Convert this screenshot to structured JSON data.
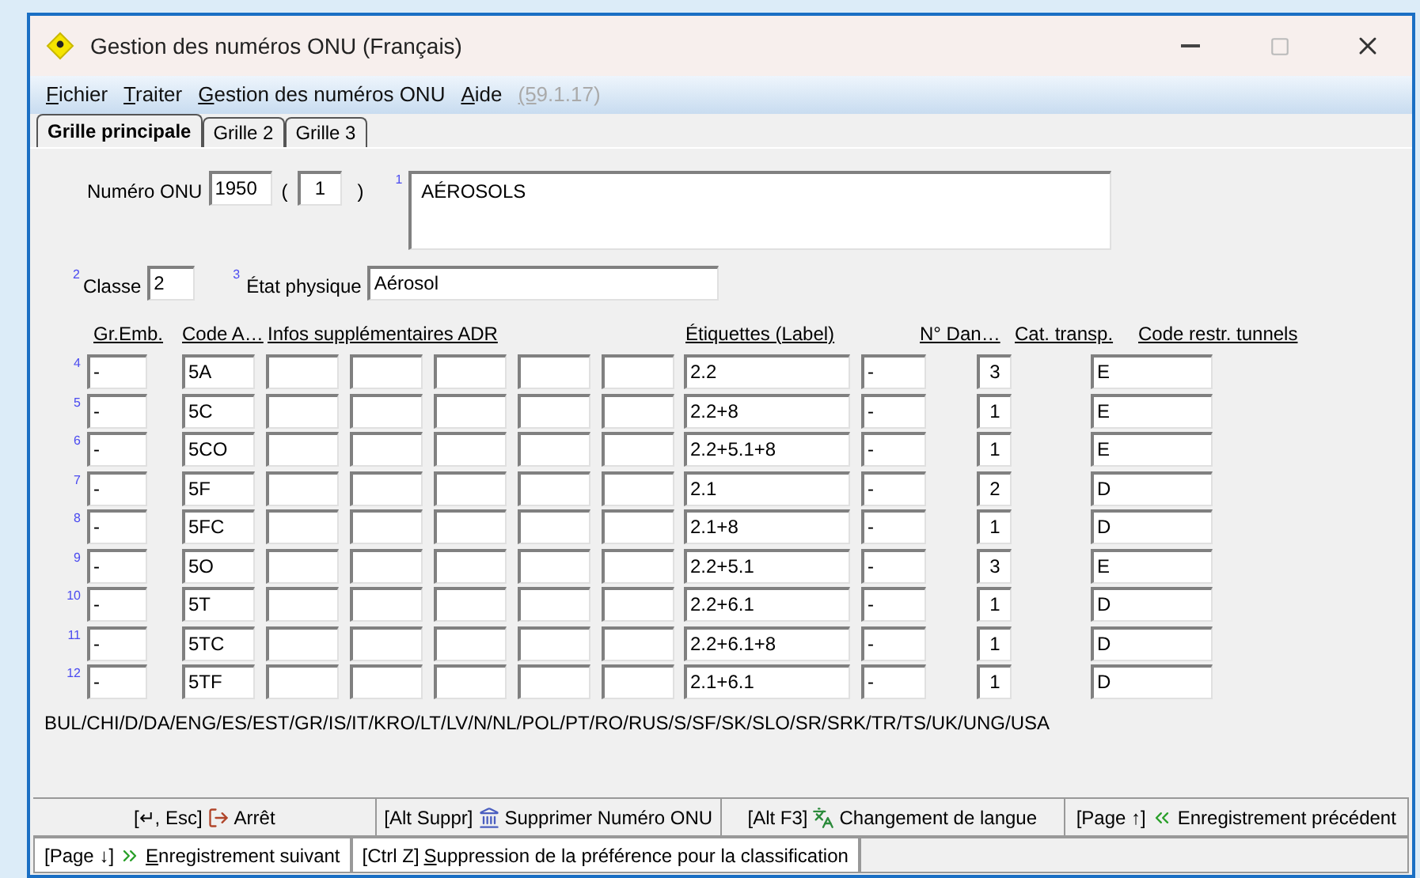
{
  "window": {
    "title": "Gestion des numéros ONU (Français)"
  },
  "menu": [
    {
      "label": "Fichier",
      "disabled": false
    },
    {
      "label": "Traiter",
      "disabled": false
    },
    {
      "label": "Gestion des numéros ONU",
      "disabled": false
    },
    {
      "label": "Aide",
      "disabled": false
    },
    {
      "label": "(59.1.17)",
      "disabled": true
    }
  ],
  "tabs": [
    {
      "label": "Grille principale",
      "selected": true
    },
    {
      "label": "Grille 2",
      "selected": false
    },
    {
      "label": "Grille 3",
      "selected": false
    }
  ],
  "un_number": {
    "label": "Numéro ONU",
    "value": "1950",
    "open_paren": "(",
    "variant": "1",
    "close_paren": ")"
  },
  "name": {
    "marker": "1",
    "value": "AÉROSOLS"
  },
  "class": {
    "marker": "2",
    "label": "Classe",
    "value": "2"
  },
  "physical_state": {
    "marker": "3",
    "label": "État physique",
    "value": "Aérosol"
  },
  "table": {
    "columns": [
      "Gr.Emb.",
      "Code A…",
      "Infos supplémentaires ADR",
      "Étiquettes (Label)",
      "N° Dan…",
      "Cat. transp.",
      "Code restr. tunnels"
    ],
    "rows": [
      {
        "marker": "4",
        "packing_group": "-",
        "code": "5A",
        "labels": "2.2",
        "danger_no": "-",
        "transport_cat": "3",
        "tunnel_code": "E"
      },
      {
        "marker": "5",
        "packing_group": "-",
        "code": "5C",
        "labels": "2.2+8",
        "danger_no": "-",
        "transport_cat": "1",
        "tunnel_code": "E"
      },
      {
        "marker": "6",
        "packing_group": "-",
        "code": "5CO",
        "labels": "2.2+5.1+8",
        "danger_no": "-",
        "transport_cat": "1",
        "tunnel_code": "E"
      },
      {
        "marker": "7",
        "packing_group": "-",
        "code": "5F",
        "labels": "2.1",
        "danger_no": "-",
        "transport_cat": "2",
        "tunnel_code": "D"
      },
      {
        "marker": "8",
        "packing_group": "-",
        "code": "5FC",
        "labels": "2.1+8",
        "danger_no": "-",
        "transport_cat": "1",
        "tunnel_code": "D"
      },
      {
        "marker": "9",
        "packing_group": "-",
        "code": "5O",
        "labels": "2.2+5.1",
        "danger_no": "-",
        "transport_cat": "3",
        "tunnel_code": "E"
      },
      {
        "marker": "10",
        "packing_group": "-",
        "code": "5T",
        "labels": "2.2+6.1",
        "danger_no": "-",
        "transport_cat": "1",
        "tunnel_code": "D"
      },
      {
        "marker": "11",
        "packing_group": "-",
        "code": "5TC",
        "labels": "2.2+6.1+8",
        "danger_no": "-",
        "transport_cat": "1",
        "tunnel_code": "D"
      },
      {
        "marker": "12",
        "packing_group": "-",
        "code": "5TF",
        "labels": "2.1+6.1",
        "danger_no": "-",
        "transport_cat": "1",
        "tunnel_code": "D"
      }
    ]
  },
  "languages": "BUL/CHI/D/DA/ENG/ES/EST/GR/IS/IT/KRO/LT/LV/N/NL/POL/PT/RO/RUS/S/SF/SK/SLO/SR/SRK/TR/TS/UK/UNG/USA",
  "buttons": [
    {
      "kind": "exit",
      "key": "[↵, Esc]",
      "label": "Arrêt"
    },
    {
      "kind": "delete",
      "key": "[Alt Suppr]",
      "label": "Supprimer Numéro ONU"
    },
    {
      "kind": "language",
      "key": "[Alt F3]",
      "label": "Changement de langue"
    },
    {
      "kind": "previous",
      "key": "[Page ↑]",
      "label": "Enregistrement précédent"
    }
  ],
  "status_bar": [
    {
      "kind": "next",
      "key": "[Page ↓]",
      "label": "Enregistrement suivant"
    },
    {
      "kind": "plain",
      "key": "[Ctrl Z]",
      "label": "Suppression de la préférence pour la classification"
    }
  ]
}
